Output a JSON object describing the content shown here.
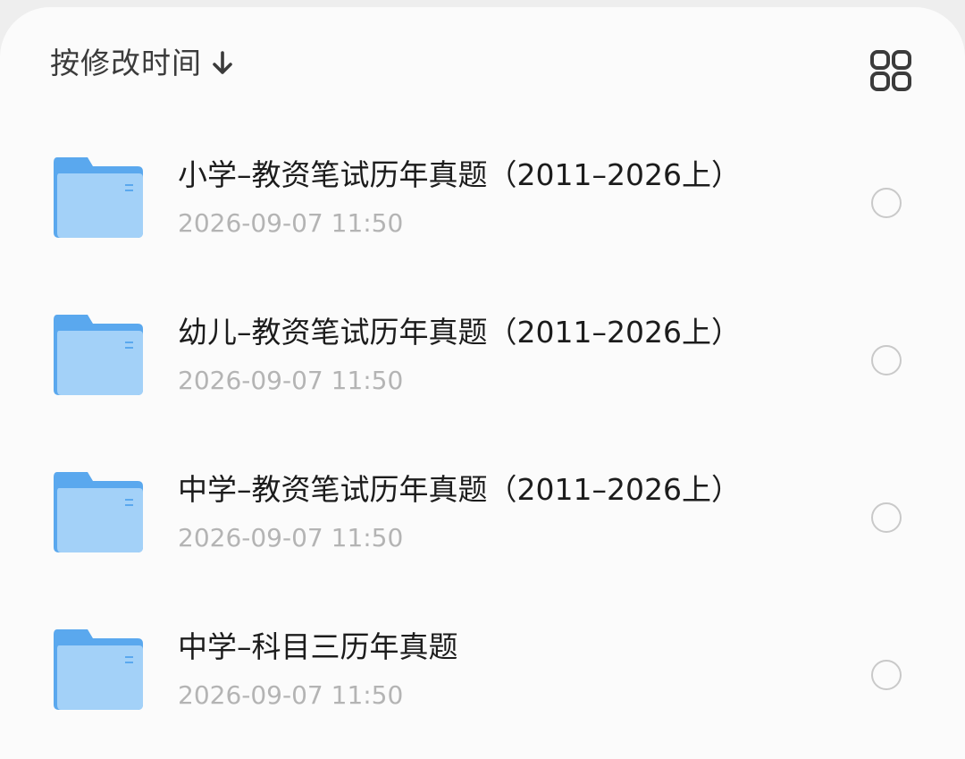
{
  "toolbar": {
    "sort_label": "按修改时间",
    "sort_direction_icon": "arrow-down-icon",
    "view_toggle_icon": "grid-view-icon"
  },
  "colors": {
    "folder_back": "#5aa8ee",
    "folder_front": "#a3d1f8",
    "title_text": "#1c1c1c",
    "date_text": "#b4b4b4",
    "radio_border": "#c9c9c9"
  },
  "files": [
    {
      "icon": "folder-icon",
      "name": "小学–教资笔试历年真题（2011–2026上）",
      "modified": "2026-09-07 11:50"
    },
    {
      "icon": "folder-icon",
      "name": "幼儿–教资笔试历年真题（2011–2026上）",
      "modified": "2026-09-07 11:50"
    },
    {
      "icon": "folder-icon",
      "name": "中学–教资笔试历年真题（2011–2026上）",
      "modified": "2026-09-07 11:50"
    },
    {
      "icon": "folder-icon",
      "name": "中学–科目三历年真题",
      "modified": "2026-09-07 11:50"
    }
  ]
}
